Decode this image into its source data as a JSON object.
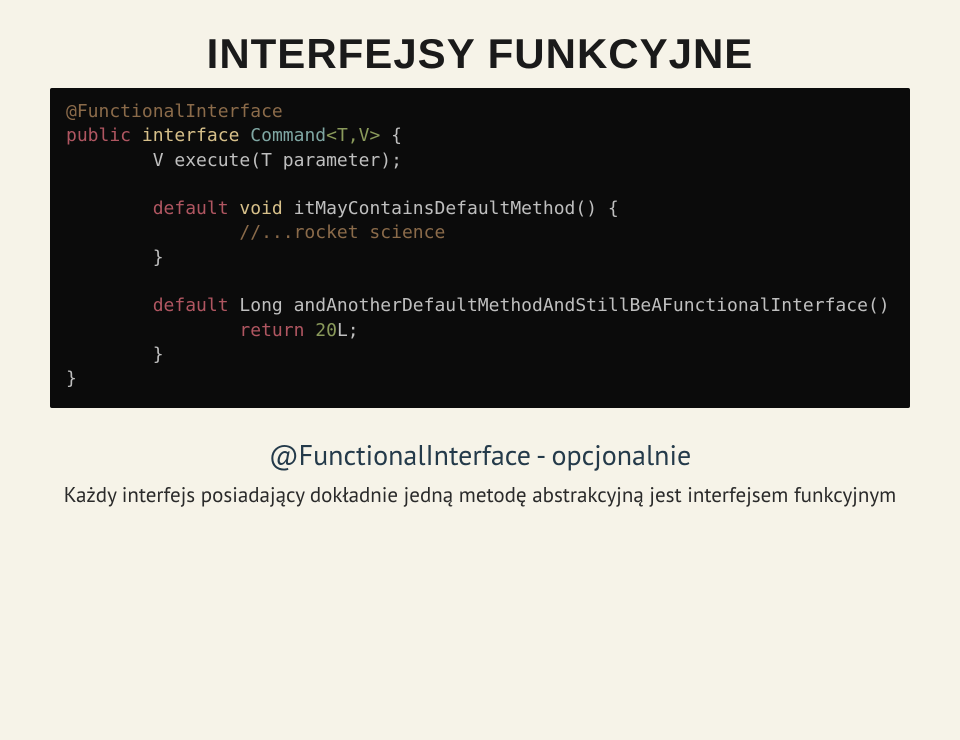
{
  "title": "INTERFEJSY FUNKCYJNE",
  "code": {
    "l1": "@FunctionalInterface",
    "l2a": "public",
    "l2b": "interface",
    "l2c": "Command",
    "l2d": "<T,V>",
    "l2e": " {",
    "l3": "        V execute(T parameter);",
    "l4": "",
    "l5a": "        ",
    "l5b": "default",
    "l5c": " ",
    "l5d": "void",
    "l5e": " itMayContainsDefaultMethod() {",
    "l6a": "                ",
    "l6b": "//...rocket science",
    "l7": "        }",
    "l8": "",
    "l9a": "        ",
    "l9b": "default",
    "l9c": " Long andAnotherDefaultMethodAndStillBeAFunctionalInterface()",
    "l10a": "                ",
    "l10b": "return",
    "l10c": " ",
    "l10d": "20",
    "l10e": "L;",
    "l11": "        }",
    "l12": "}"
  },
  "subtitle": "@FunctionalInterface - opcjonalnie",
  "body": "Każdy interfejs posiadający dokładnie jedną metodę abstrakcyjną jest interfejsem funkcyjnym"
}
